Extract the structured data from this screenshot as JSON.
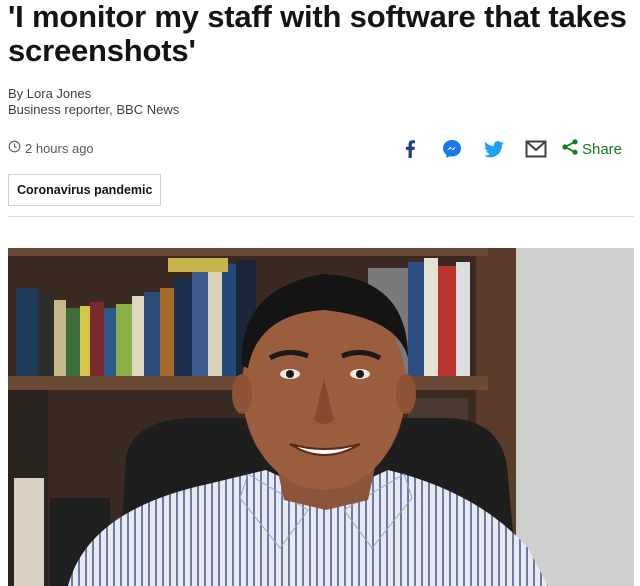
{
  "article": {
    "headline": "'I monitor my staff with software that takes screenshots'",
    "author": "By Lora Jones",
    "author_role": "Business reporter, BBC News",
    "timestamp": "2 hours ago",
    "tag": "Coronavirus pandemic"
  },
  "share": {
    "icons": [
      "facebook-icon",
      "messenger-icon",
      "twitter-icon",
      "email-icon",
      "share-icon"
    ],
    "label": "Share",
    "colors": {
      "facebook": "#1f3f86",
      "messenger": "#1877f2",
      "twitter": "#1da1f2",
      "email": "#404040",
      "share": "#118020"
    }
  }
}
